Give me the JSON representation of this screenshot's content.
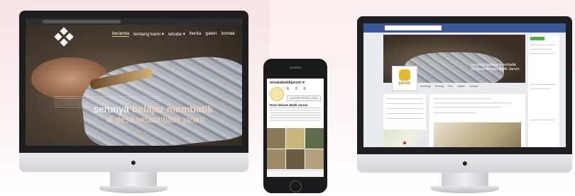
{
  "desktop_site": {
    "nav": [
      "beranda",
      "tentang kami ▾",
      "wisata ▾",
      "berita",
      "galeri",
      "kontak"
    ],
    "hero_line1_normal": "serunya ",
    "hero_line1_bold": "belajar membatik",
    "hero_line2": "di desa wisata batik jarum"
  },
  "mobile_instagram": {
    "username": "wisatabatikjarum ▾",
    "stats": [
      "8",
      "3",
      "0"
    ],
    "edit_button": "SUNTING PROFIL ANDA",
    "display_name": "Desa Wisata Batik Jarum"
  },
  "facebook_page": {
    "profile_wordmark": "jarum",
    "cover_line1": "serunya belajar membatik",
    "cover_line2": "di Desa Wisata Batik Jarum",
    "tabs": [
      "Kronologi",
      "Tentang",
      "Foto",
      "Ulasan",
      "Lainnya"
    ]
  },
  "colors": {
    "facebook_blue": "#3b5998",
    "accent_gold": "#e2b82d",
    "nav_underline": "#f0c84c"
  }
}
